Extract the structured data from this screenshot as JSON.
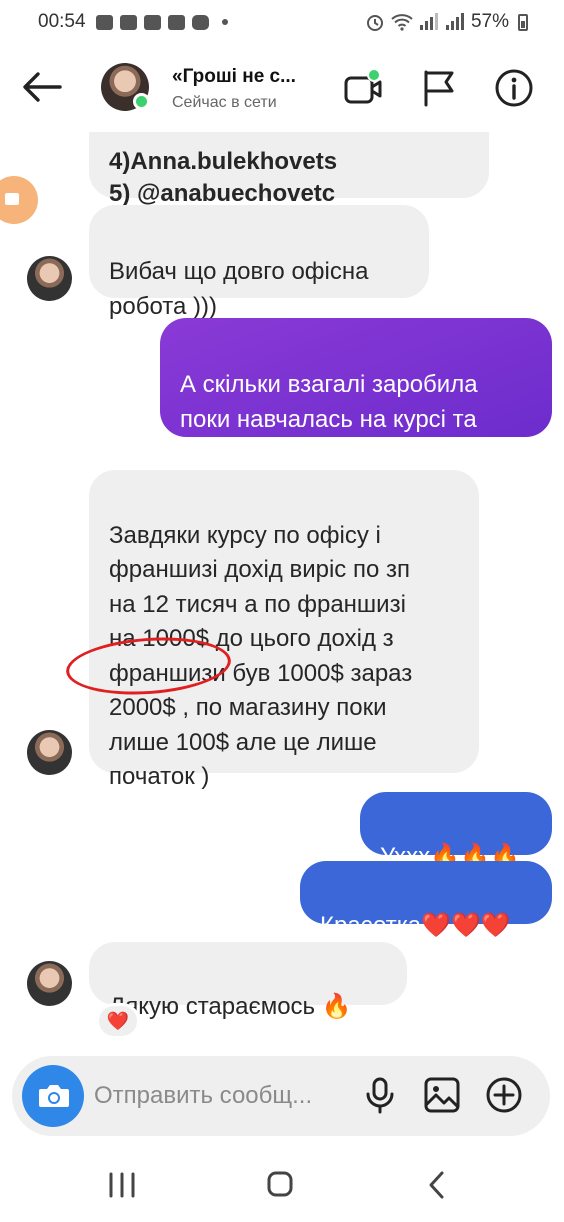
{
  "status_bar": {
    "time": "00:54",
    "battery": "57%"
  },
  "header": {
    "title": "«Гроші не с...",
    "subtitle": "Сейчас в сети"
  },
  "messages": [
    {
      "id": "m0",
      "side": "in",
      "text": "4)Anna.bulekhovets\n5) @anabuechovetc"
    },
    {
      "id": "m1",
      "side": "in",
      "text": "Вибач що довго офісна\nробота )))"
    },
    {
      "id": "m2",
      "side": "out",
      "text": "А скільки взагалі заробила\nпоки навчалась на курсі та\nзавдяки курсу?)"
    },
    {
      "id": "m3",
      "side": "in",
      "text": "Завдяки курсу по офісу і\nфраншизі дохід виріс по зп\nна 12 тисяч а по франшизі\nна 1000$ до цього дохід з\nфраншизи був 1000$ зараз\n2000$ , по магазину поки\nлише 100$ але це лише\nпочаток )"
    },
    {
      "id": "m4",
      "side": "out",
      "text": "Ухxx",
      "emoji": "🔥🔥🔥"
    },
    {
      "id": "m5",
      "side": "out",
      "text": "Красотка",
      "emoji": "❤️❤️❤️"
    },
    {
      "id": "m6",
      "side": "in",
      "text": "Дякую стараємось",
      "emoji": "🔥"
    }
  ],
  "reaction": "❤️",
  "composer": {
    "placeholder": "Отправить сообщ..."
  },
  "icons": {
    "back": "back-arrow-icon",
    "video": "video-call-icon",
    "flag": "flag-icon",
    "info": "info-icon",
    "camera": "camera-icon",
    "mic": "microphone-icon",
    "gallery": "gallery-icon",
    "add": "add-icon"
  },
  "colors": {
    "purple_bubble": "#7b33d2",
    "blue_bubble": "#3b67d8",
    "incoming_bubble": "#efefef",
    "online": "#3bd16f",
    "annotation": "#e02020"
  }
}
